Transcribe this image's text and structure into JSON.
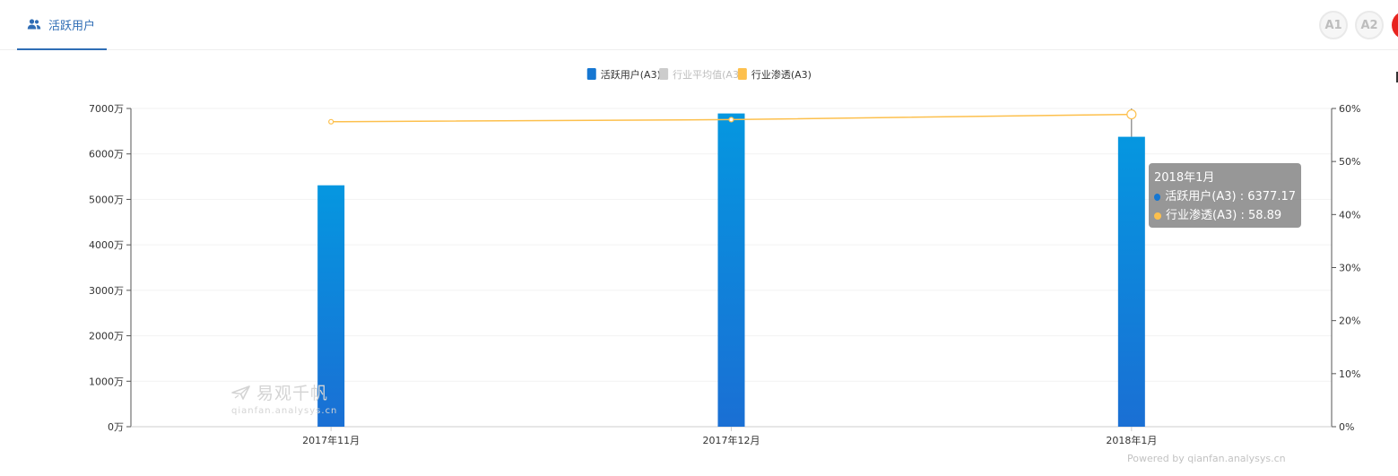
{
  "tab": {
    "label": "活跃用户"
  },
  "buttons": [
    {
      "label": "A1"
    },
    {
      "label": "A2"
    }
  ],
  "legend": [
    {
      "label": "活跃用户(A3)",
      "color": "#1677d2",
      "active": true
    },
    {
      "label": "行业平均值(A3)",
      "color": "#cccccc",
      "active": false
    },
    {
      "label": "行业渗透(A3)",
      "color": "#fdc04d",
      "active": true
    }
  ],
  "tooltip": {
    "title": "2018年1月",
    "rows": [
      {
        "label": "活跃用户(A3) : 6377.17",
        "color": "#1677d2"
      },
      {
        "label": "行业渗透(A3) : 58.89",
        "color": "#fdc04d"
      }
    ]
  },
  "watermark": {
    "cn": "易观千帆",
    "en": "qianfan.analysys.cn"
  },
  "powered_by": "Powered by qianfan.analysys.cn",
  "chart_data": {
    "type": "bar",
    "categories": [
      "2017年11月",
      "2017年12月",
      "2018年1月"
    ],
    "series": [
      {
        "name": "活跃用户(A3)",
        "type": "bar",
        "axis": "left",
        "values": [
          5310,
          6890,
          6377.17
        ],
        "color_top": "#0597e0",
        "color_bottom": "#1a6fd4"
      },
      {
        "name": "行业渗透(A3)",
        "type": "line",
        "axis": "right",
        "values": [
          57.5,
          57.9,
          58.89
        ],
        "color": "#fdc04d"
      }
    ],
    "y_left": {
      "min": 0,
      "max": 7000,
      "step": 1000,
      "unit": "万"
    },
    "y_right": {
      "min": 0,
      "max": 60,
      "step": 10,
      "unit": "%"
    },
    "grid": true,
    "legend_position": "top-center",
    "highlighted_category": "2018年1月"
  }
}
